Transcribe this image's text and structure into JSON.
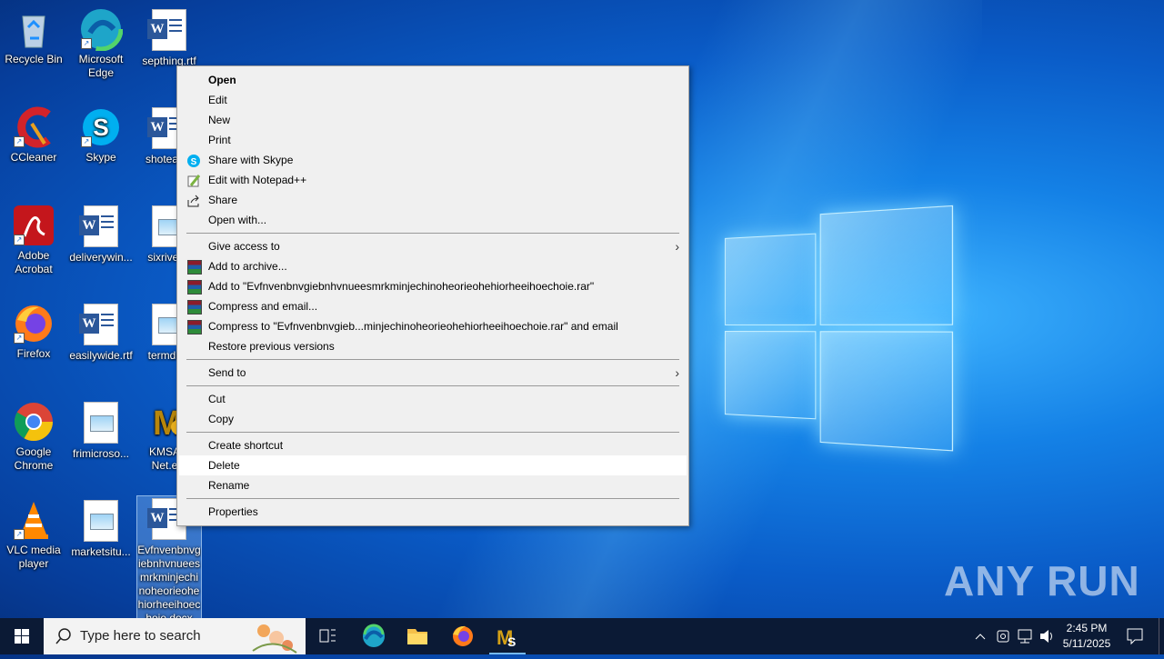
{
  "desktop": {
    "icons": [
      {
        "label": "Recycle Bin"
      },
      {
        "label": "Microsoft Edge"
      },
      {
        "label": "septhing.rtf"
      },
      {
        "label": "CCleaner"
      },
      {
        "label": "Skype"
      },
      {
        "label": "shoteas..."
      },
      {
        "label": "Adobe Acrobat"
      },
      {
        "label": "deliverywin..."
      },
      {
        "label": "sixriver..."
      },
      {
        "label": "Firefox"
      },
      {
        "label": "easilywide.rtf"
      },
      {
        "label": "termdir..."
      },
      {
        "label": "Google Chrome"
      },
      {
        "label": "frimicroso..."
      },
      {
        "label": "KMSA... Net.e..."
      },
      {
        "label": "VLC media player"
      },
      {
        "label": "marketsitu..."
      },
      {
        "label": "Evfnvenbnvgiebnhvnueesmrkminjechinoheorieohehiorheeihoechoie.docx"
      }
    ]
  },
  "context_menu": {
    "items": [
      {
        "label": "Open"
      },
      {
        "label": "Edit"
      },
      {
        "label": "New"
      },
      {
        "label": "Print"
      },
      {
        "label": "Share with Skype"
      },
      {
        "label": "Edit with Notepad++"
      },
      {
        "label": "Share"
      },
      {
        "label": "Open with..."
      },
      {
        "label": "Give access to"
      },
      {
        "label": "Add to archive..."
      },
      {
        "label": "Add to \"Evfnvenbnvgiebnhvnueesmrkminjechinoheorieohehiorheeihoechoie.rar\""
      },
      {
        "label": "Compress and email..."
      },
      {
        "label": "Compress to \"Evfnvenbnvgieb...minjechinoheorieohehiorheeihoechoie.rar\" and email"
      },
      {
        "label": "Restore previous versions"
      },
      {
        "label": "Send to"
      },
      {
        "label": "Cut"
      },
      {
        "label": "Copy"
      },
      {
        "label": "Create shortcut"
      },
      {
        "label": "Delete"
      },
      {
        "label": "Rename"
      },
      {
        "label": "Properties"
      }
    ]
  },
  "taskbar": {
    "search_placeholder": "Type here to search",
    "clock_time": "2:45 PM",
    "clock_date": "5/11/2025"
  },
  "watermark": "ANY RUN",
  "colors": {
    "menu_bg": "#f0f0f0",
    "taskbar_bg": "#0b1a35",
    "highlight": "#ffffff"
  }
}
